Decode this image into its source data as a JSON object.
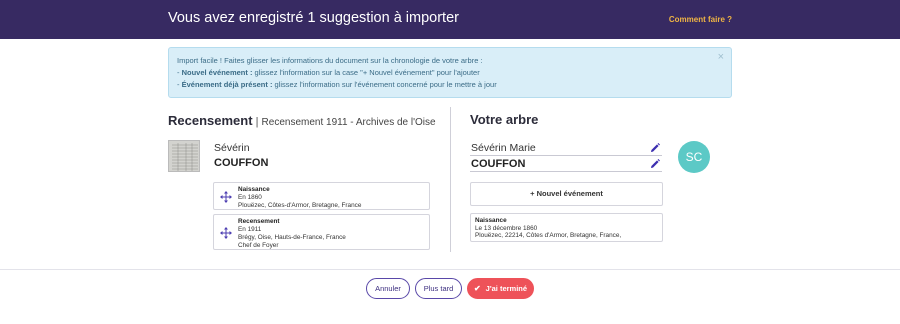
{
  "header": {
    "title": "Vous avez enregistré 1 suggestion à importer",
    "help_link": "Comment faire ?"
  },
  "info_box": {
    "line1": "Import facile ! Faites glisser les informations du document sur la chronologie de votre arbre :",
    "line2_prefix": "- ",
    "line2_bold": "Nouvel événement :",
    "line2_rest": " glissez l'information sur la case \"+ Nouvel événement\" pour l'ajouter",
    "line3_prefix": "- ",
    "line3_bold": "Événement déjà présent :",
    "line3_rest": " glissez l'information sur l'événement concerné pour le mettre à jour",
    "close_icon": "×"
  },
  "source": {
    "title": "Recensement",
    "separator": " | ",
    "subtitle": "Recensement 1911 - Archives de l'Oise",
    "first_name": "Sévérin",
    "last_name": "COUFFON",
    "events": [
      {
        "title": "Naissance",
        "line1": "En 1860",
        "line2": "Plouëzec, Côtes-d'Armor, Bretagne, France",
        "line3": ""
      },
      {
        "title": "Recensement",
        "line1": "En 1911",
        "line2": "Brégy, Oise, Hauts-de-France, France",
        "line3": "Chef de Foyer"
      }
    ]
  },
  "tree": {
    "title": "Votre arbre",
    "first_name": "Sévérin Marie",
    "last_name": "COUFFON",
    "avatar_initials": "SC",
    "new_event_label": "+ Nouvel événement",
    "events": [
      {
        "title": "Naissance",
        "line1": "Le 13 décembre 1860",
        "line2": "Plouëzec, 22214, Côtes d'Armor, Bretagne, France,"
      }
    ]
  },
  "footer": {
    "cancel_label": "Annuler",
    "later_label": "Plus tard",
    "done_label": "J'ai terminé",
    "done_icon": "✔"
  },
  "colors": {
    "header_bg": "#372a62",
    "accent_gold": "#f0b544",
    "primary_red": "#ee5259",
    "avatar_teal": "#5cc9c6",
    "info_bg": "#d9eef8",
    "purple_outline": "#5948a8"
  },
  "icons": {
    "drag": "move-arrows-icon",
    "edit": "pencil-icon",
    "check": "check-icon",
    "close": "close-icon"
  }
}
